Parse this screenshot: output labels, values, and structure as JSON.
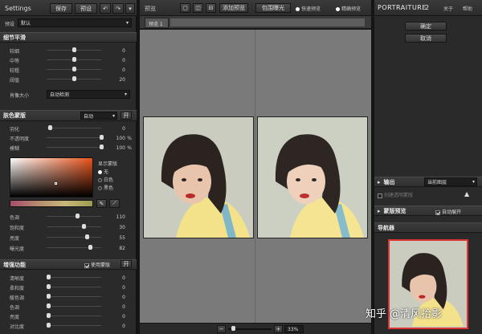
{
  "left": {
    "title": "Settings",
    "save": "保存",
    "preset_btn": "预设",
    "preset_label": "预设",
    "preset_value": "默认",
    "detail": {
      "title": "细节平滑",
      "sliders": [
        {
          "label": "较细",
          "value": "0"
        },
        {
          "label": "中等",
          "value": "0"
        },
        {
          "label": "较粗",
          "value": "0"
        },
        {
          "label": "阈值",
          "value": "20"
        }
      ],
      "size_label": "肖像大小",
      "size_value": "自动检测"
    },
    "mask": {
      "title": "肤色蒙版",
      "mode": "自动",
      "btn": "开",
      "sliders": [
        {
          "label": "羽化",
          "value": "0"
        },
        {
          "label": "不透明度",
          "value": "100",
          "unit": "%"
        },
        {
          "label": "模糊",
          "value": "100",
          "unit": "%"
        }
      ],
      "display_label": "显示蒙版",
      "radios": [
        "无",
        "白色",
        "黑色"
      ],
      "sliders2": [
        {
          "label": "色调",
          "value": "110"
        },
        {
          "label": "饱和度",
          "value": "30"
        },
        {
          "label": "亮度",
          "value": "55"
        },
        {
          "label": "曝光度",
          "value": "82"
        }
      ]
    },
    "enhance": {
      "title": "增强功能",
      "use_mask": "使用蒙版",
      "btn": "开",
      "sliders": [
        {
          "label": "清晰度",
          "value": "0"
        },
        {
          "label": "柔和度",
          "value": "0"
        },
        {
          "label": "暖色调",
          "value": "0"
        },
        {
          "label": "色调",
          "value": "0"
        },
        {
          "label": "亮度",
          "value": "0"
        },
        {
          "label": "对比度",
          "value": "0"
        }
      ]
    }
  },
  "top": {
    "preview": "预览",
    "add_preview": "添加预览",
    "crop_exposure": "包围曝光",
    "fast_preview": "快速预览",
    "precise_preview": "精确预览"
  },
  "tab": {
    "label": "预览 1"
  },
  "right": {
    "brand": "PORTRAITURE",
    "version": "2",
    "about": "关于",
    "help": "帮助",
    "ok": "确定",
    "cancel": "取消",
    "output_label": "输出",
    "output_value": "当前图层",
    "create_mask": "创建透明蒙版",
    "mask_preview": "蒙版预览",
    "auto_expand": "自动展开",
    "navigator": "导航器"
  },
  "status": {
    "zoom": "33%"
  },
  "watermark": "知乎 @清风拾影"
}
